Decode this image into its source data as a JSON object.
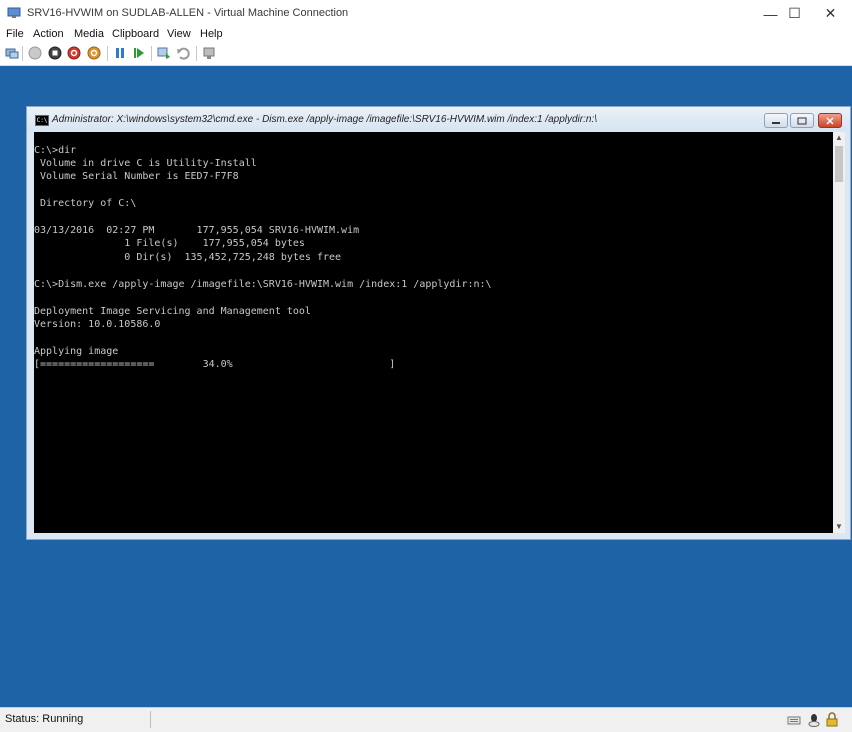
{
  "window": {
    "title": "SRV16-HVWIM on SUDLAB-ALLEN - Virtual Machine Connection",
    "minimize": "—",
    "maximize": "☐",
    "close": "✕"
  },
  "menu": {
    "items": [
      "File",
      "Action",
      "Media",
      "Clipboard",
      "View",
      "Help"
    ]
  },
  "toolbar": {
    "buttons": [
      "ctrl-alt-del",
      "start",
      "turn-off",
      "shut-down",
      "save",
      "pause",
      "reset",
      "checkpoint",
      "revert",
      "enhanced-session"
    ]
  },
  "console": {
    "title": "Administrator: X:\\windows\\system32\\cmd.exe - Dism.exe  /apply-image /imagefile:\\SRV16-HVWIM.wim /index:1 /applydir:n:\\",
    "icon_label": "C:\\",
    "lines": [
      "C:\\>dir",
      " Volume in drive C is Utility-Install",
      " Volume Serial Number is EED7-F7F8",
      "",
      " Directory of C:\\",
      "",
      "03/13/2016  02:27 PM       177,955,054 SRV16-HVWIM.wim",
      "               1 File(s)    177,955,054 bytes",
      "               0 Dir(s)  135,452,725,248 bytes free",
      "",
      "C:\\>Dism.exe /apply-image /imagefile:\\SRV16-HVWIM.wim /index:1 /applydir:n:\\",
      "",
      "Deployment Image Servicing and Management tool",
      "Version: 10.0.10586.0",
      "",
      "Applying image",
      "[===================        34.0%                          ]"
    ]
  },
  "status": {
    "text": "Status: Running"
  }
}
